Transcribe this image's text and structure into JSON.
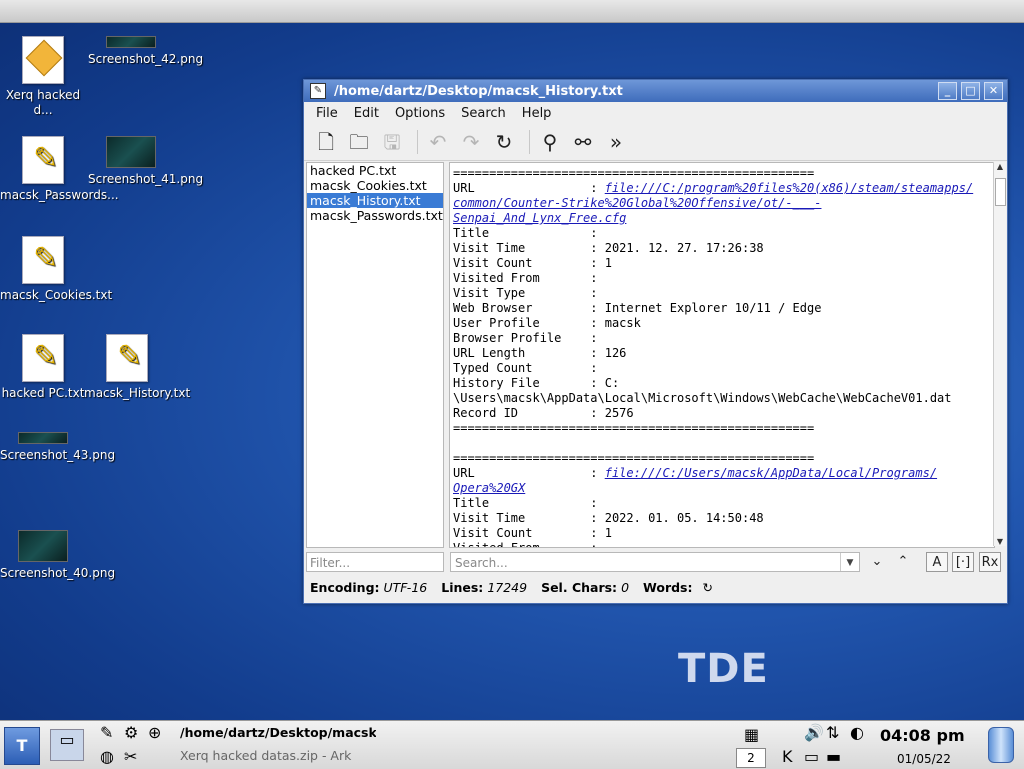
{
  "desktop": {
    "icons": [
      {
        "label": "Xerq hacked d...",
        "kind": "archive"
      },
      {
        "label": "Screenshot_42.png",
        "kind": "image"
      },
      {
        "label": "macsk_Passwords...",
        "kind": "text"
      },
      {
        "label": "Screenshot_41.png",
        "kind": "image"
      },
      {
        "label": "macsk_Cookies.txt",
        "kind": "text"
      },
      {
        "label": "hacked PC.txt",
        "kind": "text"
      },
      {
        "label": "macsk_History.txt",
        "kind": "text"
      },
      {
        "label": "Screenshot_43.png",
        "kind": "image"
      },
      {
        "label": "Screenshot_40.png",
        "kind": "image"
      }
    ],
    "branding": "TDE"
  },
  "window": {
    "title": "/home/dartz/Desktop/macsk_History.txt",
    "menu": [
      "File",
      "Edit",
      "Options",
      "Search",
      "Help"
    ],
    "toolbar_icons": [
      "new-file-icon",
      "open-folder-icon",
      "save-icon",
      "undo-icon",
      "redo-icon",
      "reload-icon",
      "find-icon",
      "find-replace-icon",
      "more-icon"
    ],
    "files": [
      {
        "name": "hacked PC.txt",
        "selected": false
      },
      {
        "name": "macsk_Cookies.txt",
        "selected": false
      },
      {
        "name": "macsk_History.txt",
        "selected": true
      },
      {
        "name": "macsk_Passwords.txt",
        "selected": false
      }
    ],
    "editor_lines": [
      "==================================================",
      "URL                : @@file:///C:/program%20files%20(x86)/steam/steamapps/",
      "@@common/Counter-Strike%20Global%20Offensive/ot/-___-",
      "@@Senpai_And_Lynx_Free.cfg",
      "Title              :",
      "Visit Time         : 2021. 12. 27. 17:26:38",
      "Visit Count        : 1",
      "Visited From       :",
      "Visit Type         :",
      "Web Browser        : Internet Explorer 10/11 / Edge",
      "User Profile       : macsk",
      "Browser Profile    :",
      "URL Length         : 126",
      "Typed Count        :",
      "History File       : C:",
      "\\Users\\macsk\\AppData\\Local\\Microsoft\\Windows\\WebCache\\WebCacheV01.dat",
      "Record ID          : 2576",
      "==================================================",
      "",
      "==================================================",
      "URL                : @@file:///C:/Users/macsk/AppData/Local/Programs/",
      "@@Opera%20GX",
      "Title              :",
      "Visit Time         : 2022. 01. 05. 14:50:48",
      "Visit Count        : 1",
      "Visited From       :"
    ],
    "filter_placeholder": "Filter...",
    "search_placeholder": "Search...",
    "status": {
      "encoding_label": "Encoding:",
      "encoding": "UTF-16",
      "lines_label": "Lines:",
      "lines": "17249",
      "sel_label": "Sel. Chars:",
      "sel": "0",
      "words_label": "Words:"
    }
  },
  "taskbar": {
    "tasks": [
      {
        "label": "/home/dartz/Desktop/macsk_History.txt",
        "active": true
      },
      {
        "label": "Xerq hacked datas.zip - Ark",
        "active": false
      }
    ],
    "pager": "2",
    "clock": "04:08 pm",
    "date": "01/05/22"
  }
}
